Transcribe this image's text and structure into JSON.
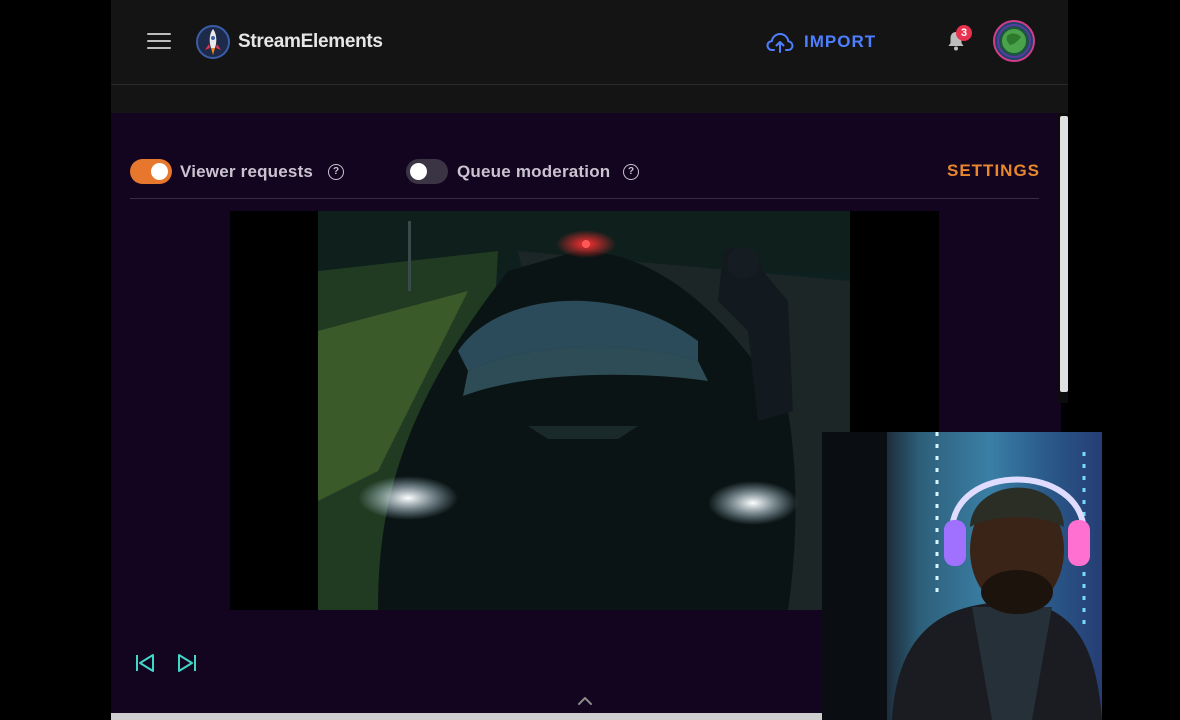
{
  "header": {
    "brand": "StreamElements",
    "import_label": "IMPORT",
    "notification_count": "3"
  },
  "controls": {
    "viewer_requests": {
      "label": "Viewer requests",
      "enabled": true
    },
    "queue_moderation": {
      "label": "Queue moderation",
      "enabled": false
    },
    "settings_label": "SETTINGS"
  },
  "colors": {
    "accent_orange": "#e8772e",
    "import_blue": "#4f7fff",
    "panel_bg": "#13041f",
    "transport_teal": "#3fd8c8",
    "badge_red": "#e8324f"
  },
  "icons": {
    "menu": "hamburger-menu-icon",
    "logo": "rocket-logo-icon",
    "import": "cloud-upload-icon",
    "notifications": "bell-icon",
    "help": "help-circle-icon",
    "previous": "skip-previous-icon",
    "next": "skip-next-icon",
    "expand": "chevron-up-icon"
  }
}
